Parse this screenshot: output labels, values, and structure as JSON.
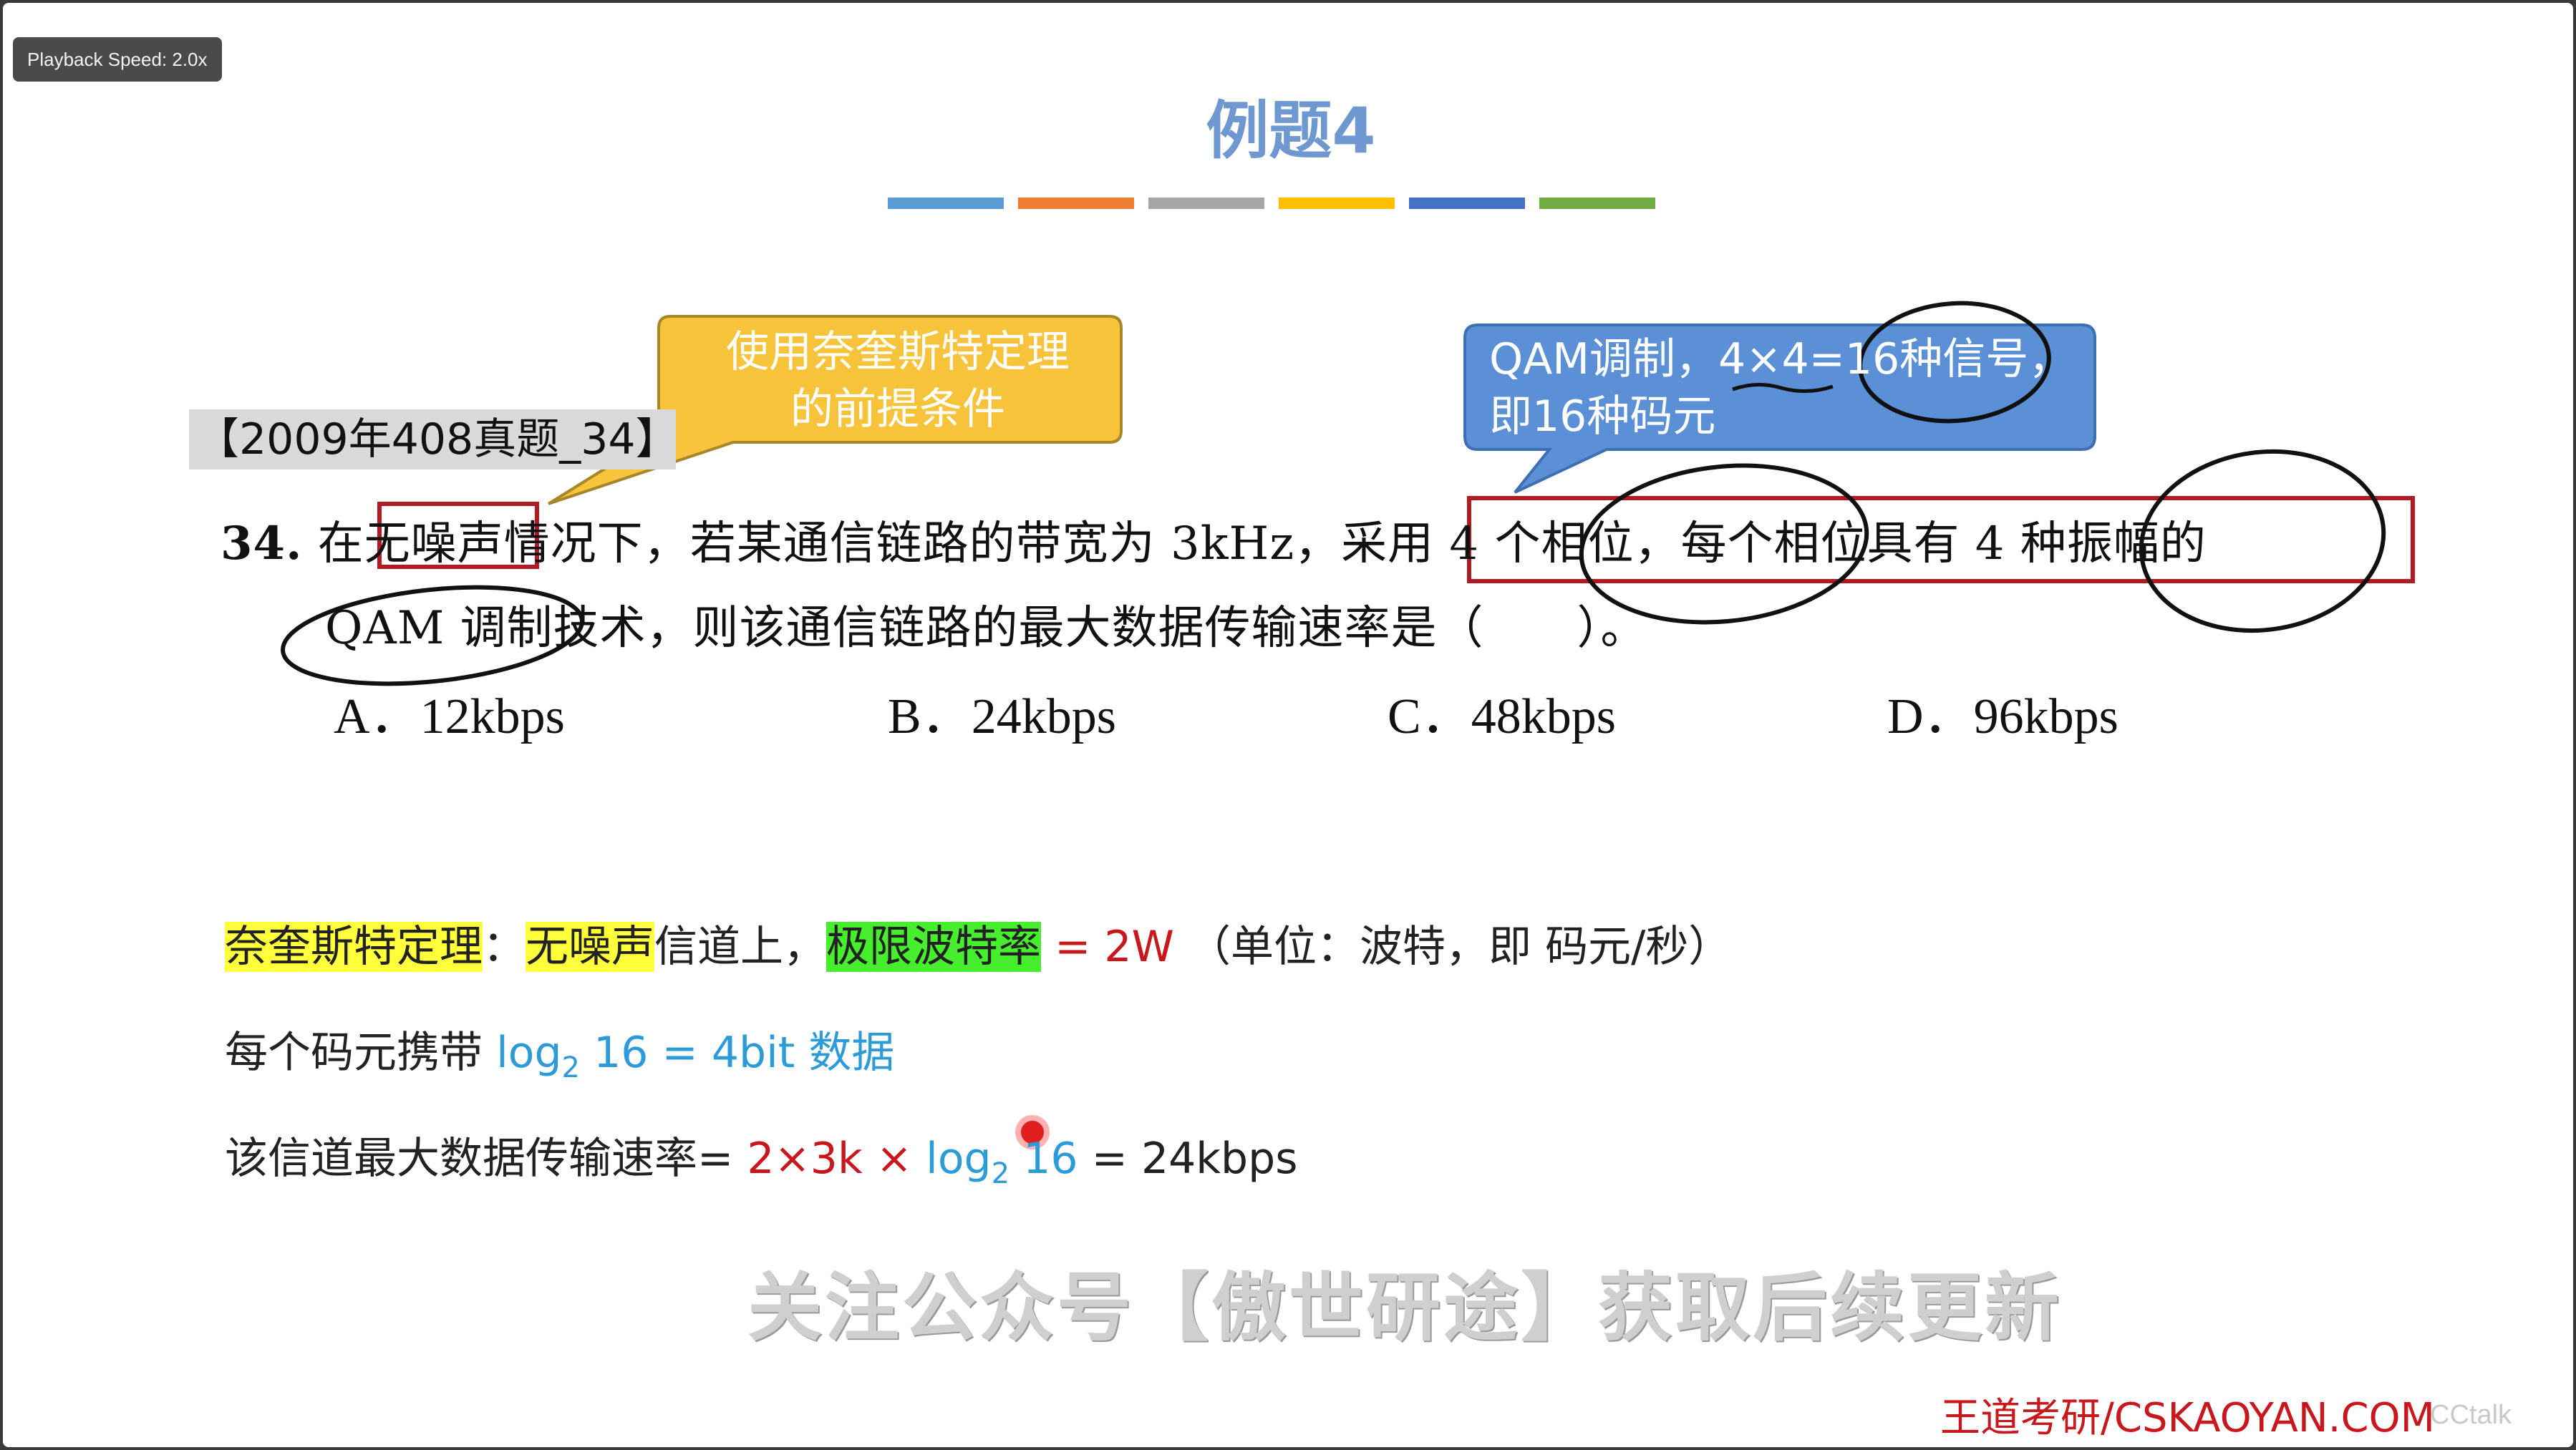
{
  "player": {
    "speed_label": "Playback Speed: 2.0x"
  },
  "slide": {
    "title": "例题4",
    "strip_colors": [
      "#5b9bd5",
      "#ed7d31",
      "#a5a5a5",
      "#ffc000",
      "#4472c4",
      "#70ad47"
    ],
    "callout_yellow": {
      "line1": "使用奈奎斯特定理",
      "line2": "的前提条件",
      "color": "#f6c33b"
    },
    "callout_blue": {
      "line1": "QAM调制，4×4=16种信号，",
      "line2": "即16种码元",
      "color": "#5b8fd6"
    },
    "source_tag": "【2009年408真题_34】",
    "question": {
      "number": "34.",
      "pre_box": "在",
      "boxed_condition": "无噪声",
      "line1_mid": "情况下，若某通信链路的带宽为 3kHz，",
      "line1_boxed": "采用 4 个相位，每个相位具有 4 种振幅",
      "line1_end": "的",
      "line2": "QAM 调制技术，则该通信链路的最大数据传输速率是（　　）。"
    },
    "options": [
      {
        "letter": "A．",
        "value": "12kbps"
      },
      {
        "letter": "B．",
        "value": "24kbps"
      },
      {
        "letter": "C．",
        "value": "48kbps"
      },
      {
        "letter": "D．",
        "value": "96kbps"
      }
    ],
    "notes": {
      "line1": {
        "theorem": "奈奎斯特定理",
        "colon": "：",
        "condition": "无噪声",
        "channel": "信道上，",
        "limit": "极限波特率",
        "formula": "= 2W",
        "unit": "（单位：波特，即 码元/秒）"
      },
      "line2": {
        "prefix": "每个码元携带",
        "log": "log",
        "base": "2",
        "rest": "16 = 4bit 数据"
      },
      "line3": {
        "prefix": "该信道最大数据传输速率",
        "eq": "=",
        "red_part": "2×3k ×",
        "log": "log",
        "base": "2",
        "blue_part": "16",
        "result": "= 24kbps"
      }
    },
    "watermark": "关注公众号【傲世研途】获取后续更新",
    "brand": "王道考研/CSKAOYAN.COM",
    "player_logo": "CCtalk"
  }
}
